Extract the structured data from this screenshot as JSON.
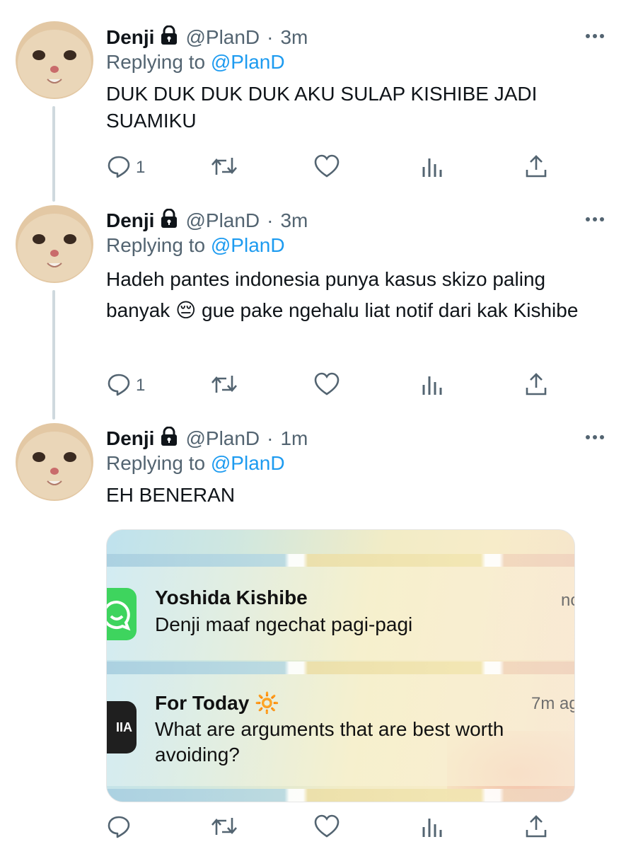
{
  "colors": {
    "accent": "#1d9bf0",
    "secondary_text": "#536471",
    "thread_line": "#cfd9de"
  },
  "tweets": [
    {
      "name": "Denji",
      "handle": "@PlanD",
      "time": "3m",
      "dot": "·",
      "replying_label": "Replying to ",
      "replying_handle": "@PlanD",
      "text": "DUK DUK DUK DUK AKU SULAP KISHIBE JADI SUAMIKU",
      "reply_count": "1"
    },
    {
      "name": "Denji",
      "handle": "@PlanD",
      "time": "3m",
      "dot": "·",
      "replying_label": "Replying to ",
      "replying_handle": "@PlanD",
      "text_part1": "Hadeh pantes indonesia punya kasus skizo paling banyak",
      "emoji": "😔",
      "text_part2": " gue pake ngehalu liat notif dari kak Kishibe",
      "reply_count": "1"
    },
    {
      "name": "Denji",
      "handle": "@PlanD",
      "time": "1m",
      "dot": "·",
      "replying_label": "Replying to ",
      "replying_handle": "@PlanD",
      "text": "EH BENERAN",
      "reply_count": ""
    }
  ],
  "media": {
    "notifications": [
      {
        "title": "Yoshida Kishibe",
        "body": "Denji maaf ngechat pagi-pagi",
        "time": "no",
        "app_icon": "whatsapp-icon"
      },
      {
        "title": "For Today",
        "title_emoji": "🔆",
        "body": "What are arguments that are best worth avoiding?",
        "time": "7m ag",
        "app_icon": "app-icon",
        "icon_text": "IIA"
      }
    ]
  },
  "icons": [
    "lock-icon",
    "more-icon",
    "reply-icon",
    "retweet-icon",
    "like-icon",
    "analytics-icon",
    "share-icon"
  ]
}
